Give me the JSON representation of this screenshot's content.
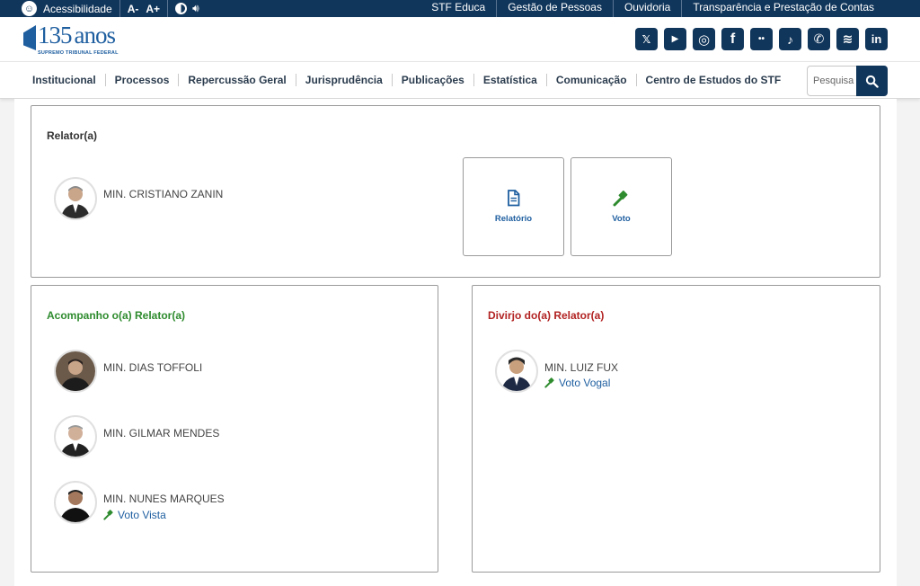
{
  "topbar": {
    "accessibility_label": "Acessibilidade",
    "font_decrease": "A-",
    "font_increase": "A+",
    "links": [
      "STF Educa",
      "Gestão de Pessoas",
      "Ouvidoria",
      "Transparência e Prestação de Contas"
    ]
  },
  "header": {
    "logo_number": "135",
    "logo_word": "anos",
    "logo_subtitle": "SUPREMO TRIBUNAL FEDERAL",
    "socials": [
      {
        "icon": "x-icon",
        "glyph": "𝕏"
      },
      {
        "icon": "youtube-icon",
        "glyph": "▶"
      },
      {
        "icon": "instagram-icon",
        "glyph": "◎"
      },
      {
        "icon": "facebook-icon",
        "glyph": "f"
      },
      {
        "icon": "flickr-icon",
        "glyph": "••"
      },
      {
        "icon": "tiktok-icon",
        "glyph": "♪"
      },
      {
        "icon": "whatsapp-icon",
        "glyph": "✆"
      },
      {
        "icon": "spotify-icon",
        "glyph": "≋"
      },
      {
        "icon": "linkedin-icon",
        "glyph": "in"
      }
    ]
  },
  "nav": {
    "items": [
      "Institucional",
      "Processos",
      "Repercussão Geral",
      "Jurisprudência",
      "Publicações",
      "Estatística",
      "Comunicação",
      "Centro de Estudos do STF"
    ],
    "search_placeholder": "Pesquisa"
  },
  "relator": {
    "title": "Relator(a)",
    "minister": "MIN. CRISTIANO ZANIN",
    "relatorio_label": "Relatório",
    "voto_label": "Voto"
  },
  "acompanho": {
    "title": "Acompanho o(a) Relator(a)",
    "ministers": [
      {
        "name": "MIN. DIAS TOFFOLI",
        "vote_link": ""
      },
      {
        "name": "MIN. GILMAR MENDES",
        "vote_link": ""
      },
      {
        "name": "MIN. NUNES MARQUES",
        "vote_link": "Voto Vista"
      }
    ]
  },
  "divirjo": {
    "title": "Divirjo do(a) Relator(a)",
    "ministers": [
      {
        "name": "MIN. LUIZ FUX",
        "vote_link": "Voto Vogal"
      }
    ]
  },
  "colors": {
    "navy": "#11365b",
    "link_blue": "#1f5fa0",
    "agree_green": "#2e8b2e",
    "disagree_red": "#b22222",
    "gavel_green": "#2e8b2e"
  }
}
